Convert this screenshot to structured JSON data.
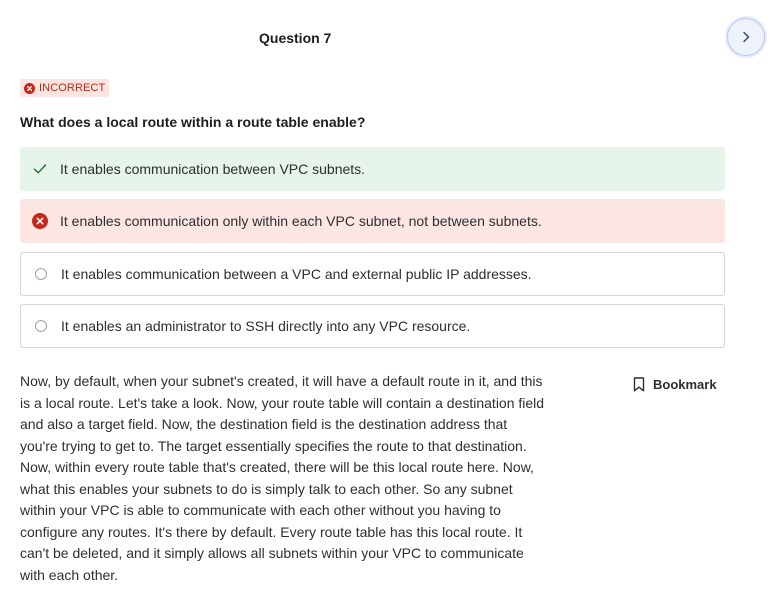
{
  "question": {
    "title": "Question 7",
    "status_badge": "INCORRECT",
    "prompt": "What does a local route within a route table enable?"
  },
  "options": [
    {
      "label": "It enables communication between VPC subnets.",
      "state": "correct",
      "icon": "check-icon"
    },
    {
      "label": "It enables communication only within each VPC subnet, not between subnets.",
      "state": "incorrect-selected",
      "icon": "x-circle-icon"
    },
    {
      "label": "It enables communication between a VPC and external public IP addresses.",
      "state": "unselected",
      "icon": "radio-icon"
    },
    {
      "label": "It enables an administrator to SSH directly into any VPC resource.",
      "state": "unselected",
      "icon": "radio-icon"
    }
  ],
  "explanation": "Now, by default, when your subnet's created, it will have a default route in it, and this is a local route. Let's take a look. Now, your route table will contain a destination field and also a target field. Now, the destination field is the destination address that you're trying to get to. The target essentially specifies the route to that destination. Now, within every route table that's created, there will be this local route here. Now, what this enables your subnets to do is simply talk to each other. So any subnet within your VPC is able to communicate with each other without you having to configure any routes. It's there by default. Every route table has this local route. It can't be deleted, and it simply allows all subnets within your VPC to communicate with each other.",
  "bookmark": {
    "label": "Bookmark",
    "icon": "bookmark-icon"
  },
  "navigation": {
    "next_icon": "chevron-right-icon"
  },
  "colors": {
    "correct_bg": "#e6f4ea",
    "incorrect_bg": "#fce6e4",
    "incorrect_accent": "#c4261a",
    "correct_accent": "#1e6b3a",
    "next_button_border": "#b9c6ee"
  }
}
